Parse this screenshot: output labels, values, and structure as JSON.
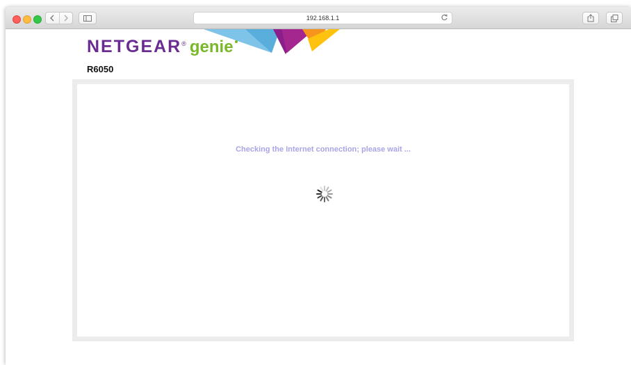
{
  "browser": {
    "url": "192.168.1.1"
  },
  "brand": {
    "netgear": "NETGEAR",
    "registered": "®",
    "genie": "genie",
    "model": "R6050",
    "colors": {
      "purple": "#6b2c91",
      "green": "#7bb72b"
    }
  },
  "main": {
    "status_message": "Checking the Internet connection; please wait ...",
    "status_color": "#a9a5e6",
    "spinner_icon": "loading-spinner-icon"
  }
}
